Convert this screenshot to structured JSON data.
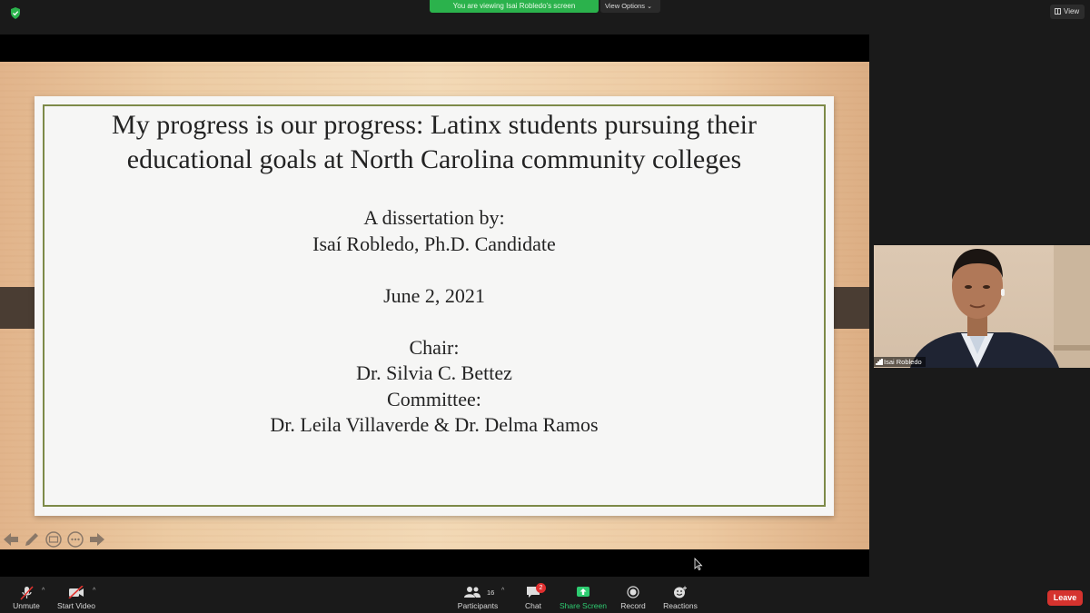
{
  "top_bar": {
    "viewing_banner": "You are viewing Isai Robledo's screen",
    "view_options_label": "View Options",
    "view_button_label": "View"
  },
  "slide": {
    "title_lines": [
      "My progress is our progress: Latinx students pursuing their",
      "educational goals at North Carolina community colleges"
    ],
    "byline_intro": "A dissertation by:",
    "author": "Isaí Robledo, Ph.D. Candidate",
    "date": "June 2, 2021",
    "chair_heading": "Chair:",
    "chair_name": "Dr. Silvia C. Bettez",
    "committee_heading": "Committee:",
    "committee_names": "Dr. Leila Villaverde & Dr. Delma Ramos",
    "colors": {
      "frame_border": "#7d8a48",
      "text": "#232323"
    }
  },
  "slide_tools": [
    "arrow-left-icon",
    "pen-icon",
    "slides-icon",
    "more-icon",
    "arrow-right-icon"
  ],
  "participant_video": {
    "name": "Isai Robledo"
  },
  "toolbar": {
    "unmute_label": "Unmute",
    "start_video_label": "Start Video",
    "participants_label": "Participants",
    "participants_count": "16",
    "chat_label": "Chat",
    "chat_badge": "2",
    "share_screen_label": "Share Screen",
    "record_label": "Record",
    "reactions_label": "Reactions",
    "leave_label": "Leave",
    "colors": {
      "share_screen": "#2ecc71",
      "leave": "#d5332e",
      "badge": "#e02f2f"
    }
  }
}
